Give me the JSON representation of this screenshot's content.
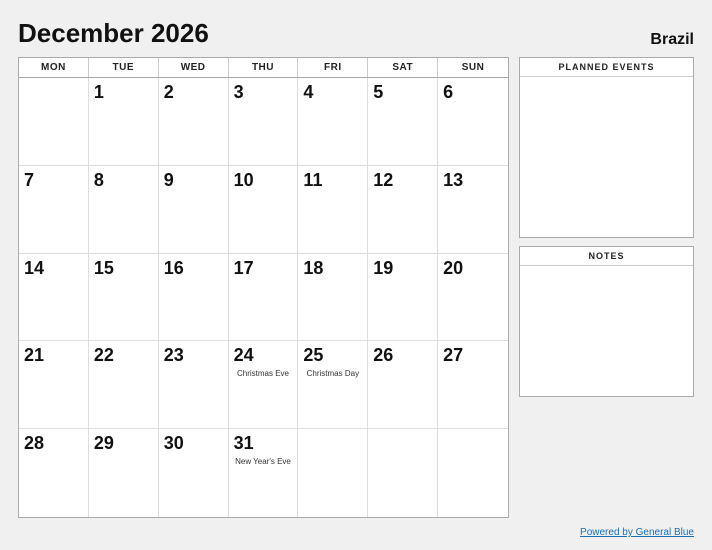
{
  "header": {
    "title": "December 2026",
    "country": "Brazil"
  },
  "days_of_week": [
    "MON",
    "TUE",
    "WED",
    "THU",
    "FRI",
    "SAT",
    "SUN"
  ],
  "calendar": {
    "weeks": [
      [
        {
          "num": "",
          "empty": true
        },
        {
          "num": "1",
          "empty": false,
          "event": ""
        },
        {
          "num": "2",
          "empty": false,
          "event": ""
        },
        {
          "num": "3",
          "empty": false,
          "event": ""
        },
        {
          "num": "4",
          "empty": false,
          "event": ""
        },
        {
          "num": "5",
          "empty": false,
          "event": ""
        },
        {
          "num": "6",
          "empty": false,
          "event": ""
        }
      ],
      [
        {
          "num": "7",
          "empty": false,
          "event": ""
        },
        {
          "num": "8",
          "empty": false,
          "event": ""
        },
        {
          "num": "9",
          "empty": false,
          "event": ""
        },
        {
          "num": "10",
          "empty": false,
          "event": ""
        },
        {
          "num": "11",
          "empty": false,
          "event": ""
        },
        {
          "num": "12",
          "empty": false,
          "event": ""
        },
        {
          "num": "13",
          "empty": false,
          "event": ""
        }
      ],
      [
        {
          "num": "14",
          "empty": false,
          "event": ""
        },
        {
          "num": "15",
          "empty": false,
          "event": ""
        },
        {
          "num": "16",
          "empty": false,
          "event": ""
        },
        {
          "num": "17",
          "empty": false,
          "event": ""
        },
        {
          "num": "18",
          "empty": false,
          "event": ""
        },
        {
          "num": "19",
          "empty": false,
          "event": ""
        },
        {
          "num": "20",
          "empty": false,
          "event": ""
        }
      ],
      [
        {
          "num": "21",
          "empty": false,
          "event": ""
        },
        {
          "num": "22",
          "empty": false,
          "event": ""
        },
        {
          "num": "23",
          "empty": false,
          "event": ""
        },
        {
          "num": "24",
          "empty": false,
          "event": "Christmas Eve"
        },
        {
          "num": "25",
          "empty": false,
          "event": "Christmas Day"
        },
        {
          "num": "26",
          "empty": false,
          "event": ""
        },
        {
          "num": "27",
          "empty": false,
          "event": ""
        }
      ],
      [
        {
          "num": "28",
          "empty": false,
          "event": ""
        },
        {
          "num": "29",
          "empty": false,
          "event": ""
        },
        {
          "num": "30",
          "empty": false,
          "event": ""
        },
        {
          "num": "31",
          "empty": false,
          "event": "New Year's Eve"
        },
        {
          "num": "",
          "empty": true,
          "event": ""
        },
        {
          "num": "",
          "empty": true,
          "event": ""
        },
        {
          "num": "",
          "empty": true,
          "event": ""
        }
      ]
    ]
  },
  "sidebar": {
    "planned_events_label": "PLANNED EVENTS",
    "notes_label": "NOTES"
  },
  "footer": {
    "link_text": "Powered by General Blue"
  }
}
